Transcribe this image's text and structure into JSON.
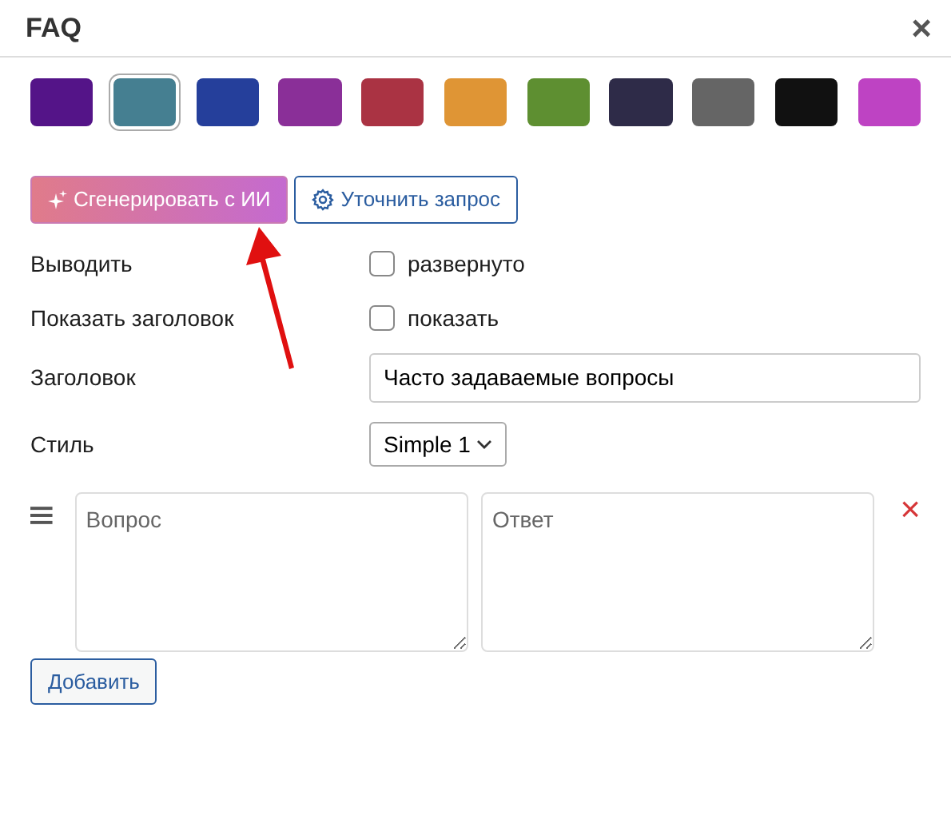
{
  "dialog": {
    "title": "FAQ",
    "close": "×"
  },
  "swatches": [
    {
      "color": "#541488",
      "selected": false
    },
    {
      "color": "#457f91",
      "selected": true
    },
    {
      "color": "#253f9b",
      "selected": false
    },
    {
      "color": "#8a2f98",
      "selected": false
    },
    {
      "color": "#aa3343",
      "selected": false
    },
    {
      "color": "#df9535",
      "selected": false
    },
    {
      "color": "#5e8f31",
      "selected": false
    },
    {
      "color": "#2e2b48",
      "selected": false
    },
    {
      "color": "#656565",
      "selected": false
    },
    {
      "color": "#111111",
      "selected": false
    },
    {
      "color": "#be43c3",
      "selected": false
    }
  ],
  "actions": {
    "generate": "Сгенерировать с ИИ",
    "refine": "Уточнить запрос"
  },
  "fields": [
    {
      "kind": "checkbox",
      "label": "Выводить",
      "text": "развернуто",
      "checked": false
    },
    {
      "kind": "checkbox",
      "label": "Показать заголовок",
      "text": "показать",
      "checked": false
    },
    {
      "kind": "text",
      "label": "Заголовок",
      "value": "Часто задаваемые вопросы"
    },
    {
      "kind": "select",
      "label": "Стиль",
      "value": "Simple 1"
    }
  ],
  "items": [
    {
      "question_placeholder": "Вопрос",
      "answer_placeholder": "Ответ",
      "remove": "×"
    }
  ],
  "add_button": "Добавить"
}
